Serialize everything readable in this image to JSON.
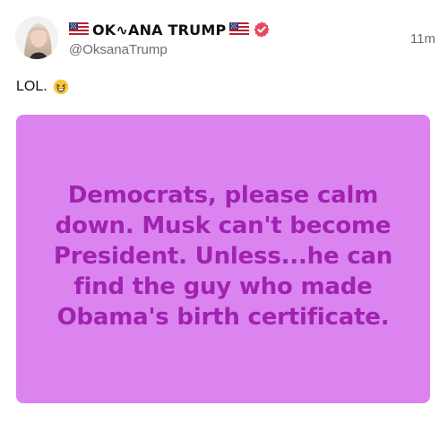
{
  "post": {
    "display_name": "OK∿ANA TRUMP",
    "handle": "@OksanaTrump",
    "timestamp": "11m",
    "text": "LOL.",
    "emoji_icon": "grinning-squinting-face-icon",
    "verified_icon": "verified-badge-icon",
    "flag_icon": "us-flag-icon"
  },
  "media": {
    "background_color": "#db84f0",
    "text_color": "#a022b0",
    "lines": [
      "Democrats, please calm",
      "down. Musk can't become",
      "President. Unless...he can",
      "find the guy who made",
      "Obama's birth certificate."
    ]
  }
}
